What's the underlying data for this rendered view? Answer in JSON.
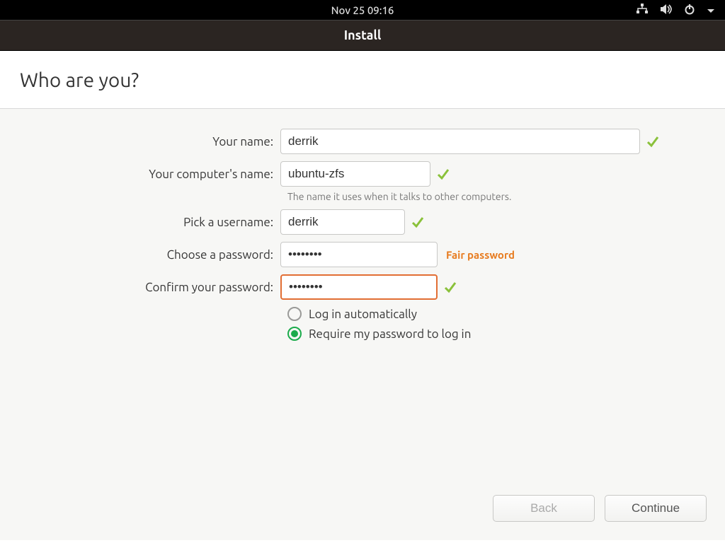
{
  "topbar": {
    "datetime": "Nov 25  09:16"
  },
  "window": {
    "title": "Install"
  },
  "page": {
    "heading": "Who are you?"
  },
  "form": {
    "name_label": "Your name:",
    "name_value": "derrik",
    "host_label": "Your computer's name:",
    "host_value": "ubuntu-zfs",
    "host_hint": "The name it uses when it talks to other computers.",
    "user_label": "Pick a username:",
    "user_value": "derrik",
    "pass_label": "Choose a password:",
    "pass_value": "••••••••",
    "pass_strength": "Fair password",
    "confirm_label": "Confirm your password:",
    "confirm_value": "••••••••",
    "auto_login_label": "Log in automatically",
    "require_pass_label": "Require my password to log in",
    "login_mode": "require_password"
  },
  "buttons": {
    "back": "Back",
    "continue": "Continue"
  }
}
